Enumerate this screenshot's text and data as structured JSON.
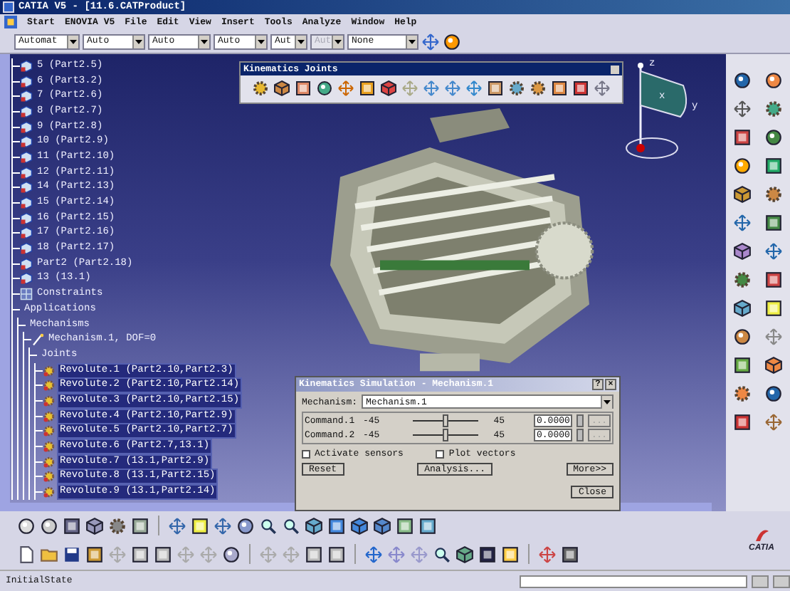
{
  "window": {
    "title": "CATIA V5 - [11.6.CATProduct]"
  },
  "menu": [
    "Start",
    "ENOVIA V5",
    "File",
    "Edit",
    "View",
    "Insert",
    "Tools",
    "Analyze",
    "Window",
    "Help"
  ],
  "toolbar": {
    "combos": [
      {
        "value": "Automat",
        "disabled": false
      },
      {
        "value": "Auto",
        "disabled": false
      },
      {
        "value": "Auto",
        "disabled": false
      },
      {
        "value": "Auto",
        "disabled": false
      },
      {
        "value": "Aut",
        "disabled": false
      },
      {
        "value": "Aut",
        "disabled": true
      },
      {
        "value": "None",
        "disabled": false
      }
    ]
  },
  "tree": [
    {
      "label": "5 (Part2.5)",
      "kind": "part",
      "selected": false
    },
    {
      "label": "6 (Part3.2)",
      "kind": "part",
      "selected": false
    },
    {
      "label": "7 (Part2.6)",
      "kind": "part",
      "selected": false
    },
    {
      "label": "8 (Part2.7)",
      "kind": "part",
      "selected": false
    },
    {
      "label": "9 (Part2.8)",
      "kind": "part",
      "selected": false
    },
    {
      "label": "10 (Part2.9)",
      "kind": "part",
      "selected": false
    },
    {
      "label": "11 (Part2.10)",
      "kind": "part",
      "selected": false
    },
    {
      "label": "12 (Part2.11)",
      "kind": "part",
      "selected": false
    },
    {
      "label": "14 (Part2.13)",
      "kind": "part",
      "selected": false
    },
    {
      "label": "15 (Part2.14)",
      "kind": "part",
      "selected": false
    },
    {
      "label": "16 (Part2.15)",
      "kind": "part",
      "selected": false
    },
    {
      "label": "17 (Part2.16)",
      "kind": "part",
      "selected": false
    },
    {
      "label": "18 (Part2.17)",
      "kind": "part",
      "selected": false
    },
    {
      "label": "Part2 (Part2.18)",
      "kind": "part",
      "selected": false
    },
    {
      "label": "13 (13.1)",
      "kind": "part",
      "selected": false
    },
    {
      "label": "Constraints",
      "kind": "constraints",
      "selected": false
    },
    {
      "label": "Applications",
      "selected": false,
      "children": [
        {
          "label": "Mechanisms",
          "selected": false,
          "children": [
            {
              "label": "Mechanism.1, DOF=0",
              "kind": "mechanism",
              "selected": false,
              "children": [
                {
                  "label": "Joints",
                  "selected": false,
                  "children": [
                    {
                      "label": "Revolute.1 (Part2.10,Part2.3)",
                      "kind": "joint",
                      "selected": true
                    },
                    {
                      "label": "Revolute.2 (Part2.10,Part2.14)",
                      "kind": "joint",
                      "selected": true
                    },
                    {
                      "label": "Revolute.3 (Part2.10,Part2.15)",
                      "kind": "joint",
                      "selected": true
                    },
                    {
                      "label": "Revolute.4 (Part2.10,Part2.9)",
                      "kind": "joint",
                      "selected": true
                    },
                    {
                      "label": "Revolute.5 (Part2.10,Part2.7)",
                      "kind": "joint",
                      "selected": true
                    },
                    {
                      "label": "Revolute.6 (Part2.7,13.1)",
                      "kind": "joint",
                      "selected": true
                    },
                    {
                      "label": "Revolute.7 (13.1,Part2.9)",
                      "kind": "joint",
                      "selected": true
                    },
                    {
                      "label": "Revolute.8 (13.1,Part2.15)",
                      "kind": "joint",
                      "selected": true
                    },
                    {
                      "label": "Revolute.9 (13.1,Part2.14)",
                      "kind": "joint",
                      "selected": true
                    }
                  ]
                }
              ]
            }
          ]
        }
      ]
    }
  ],
  "joints_toolbar": {
    "title": "Kinematics Joints"
  },
  "compass": {
    "labels": [
      "z",
      "x",
      "y"
    ]
  },
  "dialog": {
    "title": "Kinematics Simulation - Mechanism.1",
    "help": "?",
    "close": "×",
    "mechanism_label": "Mechanism:",
    "mechanism_value": "Mechanism.1",
    "commands": [
      {
        "label": "Command.1",
        "min": "-45",
        "max": "45",
        "level": 0.5,
        "value": "0.0000",
        "browse": "..."
      },
      {
        "label": "Command.2",
        "min": "-45",
        "max": "45",
        "level": 0.5,
        "value": "0.0000",
        "browse": "..."
      }
    ],
    "checkboxes": [
      {
        "label": "Activate sensors",
        "checked": false
      },
      {
        "label": "Plot vectors",
        "checked": false
      }
    ],
    "buttons": [
      "Reset",
      "Analysis...",
      "More>>"
    ],
    "close_button": "Close"
  },
  "logo": "CATIA",
  "status_bar": {
    "text": "InitialState"
  }
}
